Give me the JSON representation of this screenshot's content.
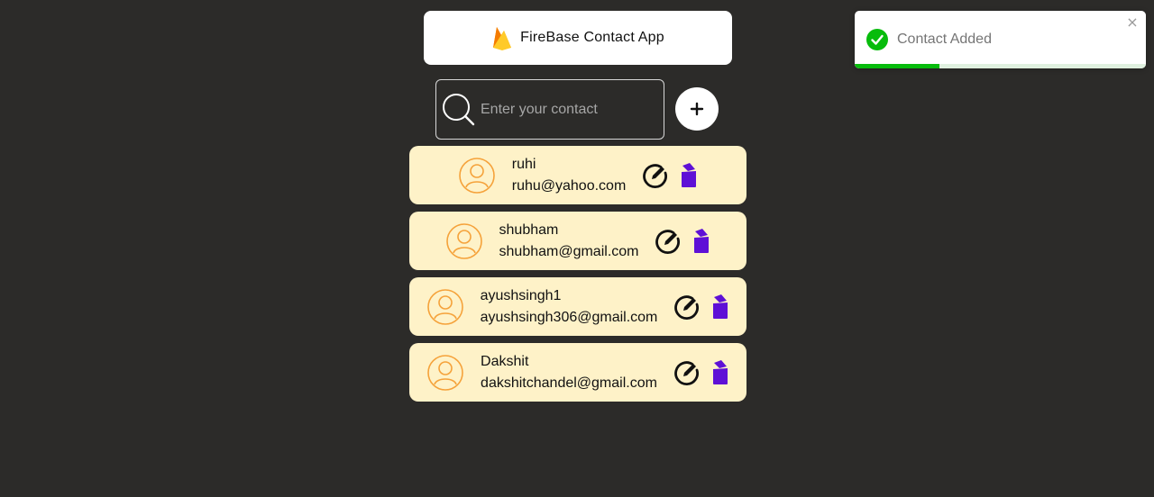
{
  "header": {
    "title": "FireBase Contact App",
    "logo_icon": "firebase-flame-icon"
  },
  "search": {
    "placeholder": "Enter your contact",
    "value": "",
    "icon": "search-icon"
  },
  "add_button": {
    "icon": "plus-icon",
    "label": "+"
  },
  "contacts": [
    {
      "name": "ruhi",
      "email": "ruhu@yahoo.com"
    },
    {
      "name": "shubham",
      "email": "shubham@gmail.com"
    },
    {
      "name": "ayushsingh1",
      "email": "ayushsingh306@gmail.com"
    },
    {
      "name": "Dakshit",
      "email": "dakshitchandel@gmail.com"
    }
  ],
  "toast": {
    "message": "Contact Added",
    "icon": "check-circle-icon",
    "close_label": "×",
    "progress_fraction": 0.29,
    "progress_color": "#07bc0c"
  },
  "colors": {
    "background": "#2c2b29",
    "card": "#fef2c8",
    "avatar": "#f5a23a",
    "delete": "#5e10d6",
    "success": "#07bc0c"
  }
}
